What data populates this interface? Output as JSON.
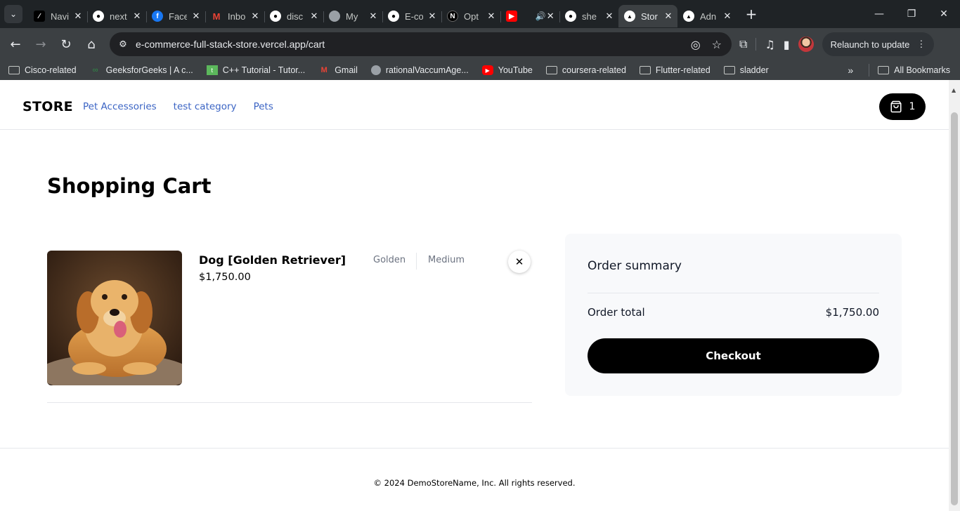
{
  "browser": {
    "tabs": [
      {
        "title": "Navi",
        "favicon": "x-logo-icon",
        "active": false
      },
      {
        "title": "next",
        "favicon": "github-icon",
        "active": false
      },
      {
        "title": "Face",
        "favicon": "facebook-icon",
        "active": false
      },
      {
        "title": "Inbo",
        "favicon": "gmail-icon",
        "active": false
      },
      {
        "title": "disc",
        "favicon": "github-icon",
        "active": false
      },
      {
        "title": "My",
        "favicon": "globe-icon",
        "active": false
      },
      {
        "title": "E-co",
        "favicon": "github-icon",
        "active": false
      },
      {
        "title": "Opt",
        "favicon": "nextjs-icon",
        "active": false
      },
      {
        "title": "",
        "favicon": "youtube-icon",
        "active": false
      },
      {
        "title": "she",
        "favicon": "github-icon",
        "active": false
      },
      {
        "title": "Stor",
        "favicon": "vercel-icon",
        "active": true
      },
      {
        "title": "Adn",
        "favicon": "vercel-icon",
        "active": false
      }
    ],
    "url": "e-commerce-full-stack-store.vercel.app/cart",
    "relaunch_label": "Relaunch to update",
    "bookmarks": [
      {
        "label": "Cisco-related",
        "icon": "folder-icon"
      },
      {
        "label": "GeeksforGeeks | A c...",
        "icon": "gfg-icon"
      },
      {
        "label": "C++ Tutorial - Tutor...",
        "icon": "tutorial-icon"
      },
      {
        "label": "Gmail",
        "icon": "gmail-icon"
      },
      {
        "label": "rationalVaccumAge...",
        "icon": "globe-icon"
      },
      {
        "label": "YouTube",
        "icon": "youtube-icon"
      },
      {
        "label": "coursera-related",
        "icon": "folder-icon"
      },
      {
        "label": "Flutter-related",
        "icon": "folder-icon"
      },
      {
        "label": "sladder",
        "icon": "folder-icon"
      }
    ],
    "all_bookmarks_label": "All Bookmarks"
  },
  "store": {
    "logo": "STORE",
    "nav": [
      "Pet Accessories",
      "test category",
      "Pets"
    ],
    "cart_count": "1",
    "page_title": "Shopping Cart",
    "item": {
      "name": "Dog [Golden Retriever]",
      "price": "$1,750.00",
      "color": "Golden",
      "size": "Medium"
    },
    "summary": {
      "title": "Order summary",
      "total_label": "Order total",
      "total_value": "$1,750.00",
      "checkout_label": "Checkout"
    },
    "footer": "© 2024 DemoStoreName, Inc. All rights reserved.",
    "colors": {
      "link": "#3b64c4",
      "button": "#000000",
      "summary_bg": "#f8f9fb"
    }
  }
}
